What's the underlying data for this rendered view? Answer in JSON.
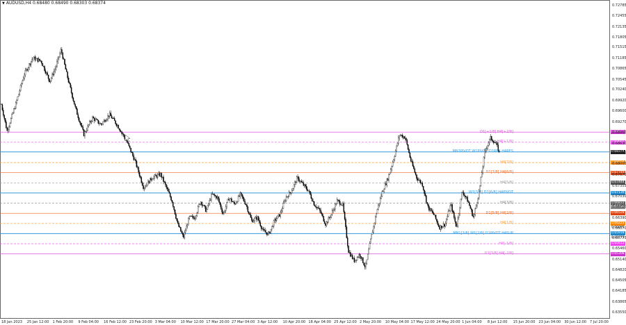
{
  "window": {
    "symbol_line": "AUDUSD,H4  0.68480 0.68490 0.68303 0.68374",
    "menu_icon": "triangle-down-icon"
  },
  "chart_data": {
    "type": "candlestick",
    "symbol": "AUDUSD",
    "timeframe": "H4",
    "ohlc_header": {
      "open": 0.6848,
      "high": 0.6849,
      "low": 0.68303,
      "close": 0.68374
    },
    "ylim": [
      0.634,
      0.729
    ],
    "y_ticks": [
      "0.72785",
      "0.72455",
      "0.72135",
      "0.71805",
      "0.71515",
      "0.71185",
      "0.70865",
      "0.70545",
      "0.70240",
      "0.69920",
      "0.69600",
      "0.69270",
      "0.68960",
      "0.68630",
      "0.68325",
      "0.68005",
      "0.67675",
      "0.67355",
      "0.67030",
      "0.66720",
      "0.66390",
      "0.66070",
      "0.65775",
      "0.65460",
      "0.65140",
      "0.64820",
      "0.64505",
      "0.64185",
      "0.63865",
      "0.63550"
    ],
    "x_ticks": [
      "18 Jan 2023",
      "25 Jan 12:00",
      "1 Feb 20:00",
      "9 Feb 04:00",
      "16 Feb 12:00",
      "23 Feb 20:00",
      "3 Mar 04:00",
      "10 Mar 12:00",
      "17 Mar 20:00",
      "27 Mar 04:00",
      "3 Apr 12:00",
      "10 Apr 20:00",
      "18 Apr 04:00",
      "25 Apr 12:00",
      "2 May 20:00",
      "10 May 04:00",
      "17 May 12:00",
      "24 May 20:00",
      "1 Jun 04:00",
      "8 Jun 12:00",
      "15 Jun 20:00",
      "23 Jun 04:00",
      "30 Jun 12:00",
      "7 Jul 20:00"
    ],
    "price_path": [
      [
        0,
        0.698
      ],
      [
        2,
        0.69
      ],
      [
        5,
        0.698
      ],
      [
        8,
        0.707
      ],
      [
        11,
        0.712
      ],
      [
        14,
        0.711
      ],
      [
        17,
        0.705
      ],
      [
        19,
        0.709
      ],
      [
        21,
        0.7145
      ],
      [
        23,
        0.707
      ],
      [
        26,
        0.697
      ],
      [
        29,
        0.689
      ],
      [
        32,
        0.694
      ],
      [
        35,
        0.692
      ],
      [
        38,
        0.695
      ],
      [
        41,
        0.6915
      ],
      [
        44,
        0.687
      ],
      [
        47,
        0.681
      ],
      [
        50,
        0.673
      ],
      [
        53,
        0.676
      ],
      [
        56,
        0.677
      ],
      [
        58,
        0.673
      ],
      [
        60,
        0.669
      ],
      [
        62,
        0.662
      ],
      [
        64,
        0.658
      ],
      [
        66,
        0.664
      ],
      [
        68,
        0.664
      ],
      [
        70,
        0.669
      ],
      [
        72,
        0.666
      ],
      [
        74,
        0.671
      ],
      [
        76,
        0.67
      ],
      [
        78,
        0.665
      ],
      [
        80,
        0.67
      ],
      [
        82,
        0.668
      ],
      [
        84,
        0.671
      ],
      [
        86,
        0.668
      ],
      [
        88,
        0.663
      ],
      [
        90,
        0.664
      ],
      [
        92,
        0.66
      ],
      [
        94,
        0.659
      ],
      [
        96,
        0.663
      ],
      [
        98,
        0.665
      ],
      [
        100,
        0.67
      ],
      [
        102,
        0.672
      ],
      [
        104,
        0.676
      ],
      [
        106,
        0.674
      ],
      [
        108,
        0.672
      ],
      [
        110,
        0.668
      ],
      [
        112,
        0.666
      ],
      [
        114,
        0.662
      ],
      [
        116,
        0.665
      ],
      [
        118,
        0.669
      ],
      [
        120,
        0.668
      ],
      [
        122,
        0.654
      ],
      [
        124,
        0.651
      ],
      [
        126,
        0.653
      ],
      [
        128,
        0.649
      ],
      [
        130,
        0.658
      ],
      [
        132,
        0.666
      ],
      [
        134,
        0.672
      ],
      [
        136,
        0.676
      ],
      [
        138,
        0.682
      ],
      [
        140,
        0.689
      ],
      [
        142,
        0.688
      ],
      [
        144,
        0.681
      ],
      [
        146,
        0.676
      ],
      [
        148,
        0.674
      ],
      [
        150,
        0.667
      ],
      [
        152,
        0.665
      ],
      [
        154,
        0.661
      ],
      [
        156,
        0.662
      ],
      [
        158,
        0.668
      ],
      [
        160,
        0.661
      ],
      [
        162,
        0.672
      ],
      [
        164,
        0.669
      ],
      [
        166,
        0.664
      ],
      [
        168,
        0.672
      ],
      [
        170,
        0.684
      ],
      [
        172,
        0.688
      ],
      [
        174,
        0.686
      ],
      [
        175,
        0.6837
      ]
    ],
    "levels": [
      {
        "label": "D1[+1/8] H4[+2/8]",
        "price": 0.6897,
        "tag": "0.68970",
        "color": "#dd55dd",
        "dash": false,
        "tag_color": "#cc33cc"
      },
      {
        "label": "H4[+1/8]",
        "price": 0.68665,
        "tag": "0.68665",
        "color": "#ee55ee",
        "dash": true,
        "tag_color": "#ee44ee"
      },
      {
        "label": "MN1PIVOT W1PIVOT D1RES H4RES",
        "price": 0.68374,
        "tag": "0.68374",
        "color": "#3399dd",
        "dash": false,
        "tag_color": "#222222"
      },
      {
        "label": "H4[7/8]",
        "price": 0.68054,
        "tag": "0.68054",
        "color": "#ff9933",
        "dash": true,
        "tag_color": "#ff8800"
      },
      {
        "label": "D1[7/8] H4[6/8]",
        "price": 0.67749,
        "tag": "0.67749",
        "color": "#ee6622",
        "dash": false,
        "tag_color": "#dd4411"
      },
      {
        "label": "H4[5/8]",
        "price": 0.67444,
        "tag": "0.67444",
        "color": "#999999",
        "dash": true,
        "tag_color": "#555555"
      },
      {
        "label": "W1[5/8] D1[6/8] H4PIVOT",
        "price": 0.67139,
        "tag": "0.67139",
        "color": "#3399dd",
        "dash": false,
        "tag_color": "#2288cc"
      },
      {
        "label": "H4[3/8]",
        "price": 0.66833,
        "tag": "0.66833",
        "color": "#888888",
        "dash": true,
        "tag_color": "#555555"
      },
      {
        "label": "D1[5/8] H4[2/8]",
        "price": 0.66528,
        "tag": "0.66528",
        "color": "#ee6622",
        "dash": false,
        "tag_color": "#dd4411"
      },
      {
        "label": "H4[1/8]",
        "price": 0.66223,
        "tag": "0.66223",
        "color": "#ff9933",
        "dash": true,
        "tag_color": "#ff8800"
      },
      {
        "label": "MN1[3/8] W1[2/8] D1PIVOT H4SUP",
        "price": 0.65918,
        "tag": "0.65918",
        "color": "#3399dd",
        "dash": false,
        "tag_color": "#2288cc"
      },
      {
        "label": "H4[-1/8]",
        "price": 0.65613,
        "tag": "0.65613",
        "color": "#ee55ee",
        "dash": true,
        "tag_color": "#ee44ee"
      },
      {
        "label": "D1[3/8] H4[-2/8]",
        "price": 0.65308,
        "tag": "0.65308",
        "color": "#dd55dd",
        "dash": false,
        "tag_color": "#cc33cc"
      }
    ],
    "extra_price_tags": [
      {
        "text": "0.66714",
        "price": 0.66714,
        "color": "#888888"
      },
      {
        "text": "0.66095",
        "price": 0.66095,
        "color": "#ffffff"
      },
      {
        "text": "0.65775",
        "price": 0.65775,
        "color": "#ffffff"
      }
    ],
    "grid": false,
    "colors": {
      "bull_candle": "#ffffff",
      "bear_candle": "#000000",
      "wick": "#000000"
    }
  }
}
